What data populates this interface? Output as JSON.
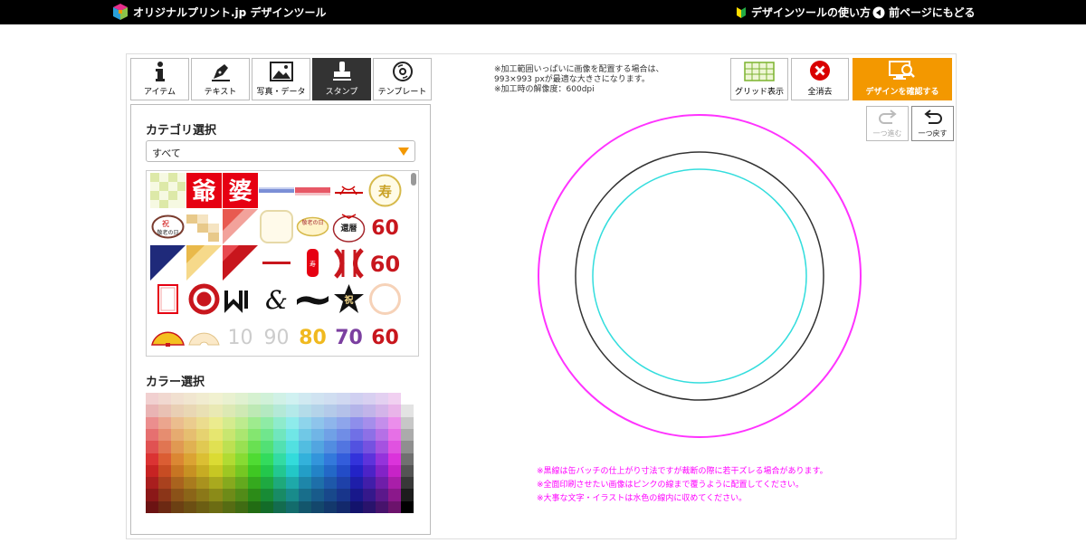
{
  "header": {
    "logo_text": "オリジナルプリント.jp  デザインツール",
    "help_label": "デザインツールの使い方",
    "back_label": "前ページにもどる"
  },
  "tabs": [
    {
      "label": "アイテム",
      "icon": "info-icon"
    },
    {
      "label": "テキスト",
      "icon": "pen-icon"
    },
    {
      "label": "写真・データ",
      "icon": "image-icon"
    },
    {
      "label": "スタンプ",
      "icon": "stamp-icon",
      "active": true
    },
    {
      "label": "テンプレート",
      "icon": "disc-icon"
    }
  ],
  "panel": {
    "category_title": "カテゴリ選択",
    "category_selected": "すべて",
    "color_title": "カラー選択"
  },
  "stamps": {
    "texts": [
      "爺",
      "婆",
      "祝",
      "敬老の日",
      "還暦",
      "60",
      "60",
      "80",
      "70",
      "60"
    ]
  },
  "toolbar": {
    "note": "※加工範囲いっぱいに画像を配置する場合は、\n993×993 pxが最適な大きさになります。\n※加工時の解像度：600dpi",
    "grid_label": "グリッド表示",
    "clear_label": "全消去",
    "confirm_label": "デザインを確認する",
    "redo_label": "一つ進む",
    "undo_label": "一つ戻す"
  },
  "canvas_notes": [
    "※黒線は缶バッチの仕上がり寸法ですが裁断の際に若干ズレる場合があります。",
    "※全面印刷させたい画像はピンクの線まで覆うように配置してください。",
    "※大事な文字・イラストは水色の線内に収めてください。"
  ],
  "colors": {
    "accent": "#f39800",
    "bleed_line": "#ff33ff",
    "cut_line": "#333333",
    "safe_line": "#33dddd"
  }
}
